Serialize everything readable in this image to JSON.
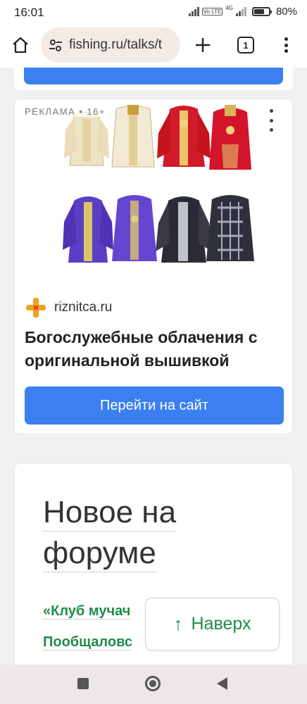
{
  "status_bar": {
    "time": "16:01",
    "volte": "Vo LTE",
    "network": "4G",
    "battery_level": 0.8,
    "battery": "80%"
  },
  "browser": {
    "url": "fishing.ru/talks/t",
    "tab_count": "1",
    "icons": [
      "home-icon",
      "site-info-icon",
      "plus-icon",
      "tabs-icon",
      "menu-icon"
    ]
  },
  "ad": {
    "label": "РЕКЛАМА • 16+",
    "image_name": "vestments-image",
    "domain": "riznitca.ru",
    "title": "Богослужебные облачения с оригинальной вышивкой",
    "cta": "Перейти на сайт"
  },
  "forum": {
    "heading_line1": "Новое на",
    "heading_line2": "форуме",
    "links": [
      "«Клуб мучач",
      "Пообщаловс"
    ]
  },
  "back_to_top": {
    "arrow": "↑",
    "label": "Наверх"
  },
  "colors": {
    "accent_blue": "#3b7ff0",
    "link_green": "#1e8b4a",
    "url_pill": "#f3ebe6"
  }
}
